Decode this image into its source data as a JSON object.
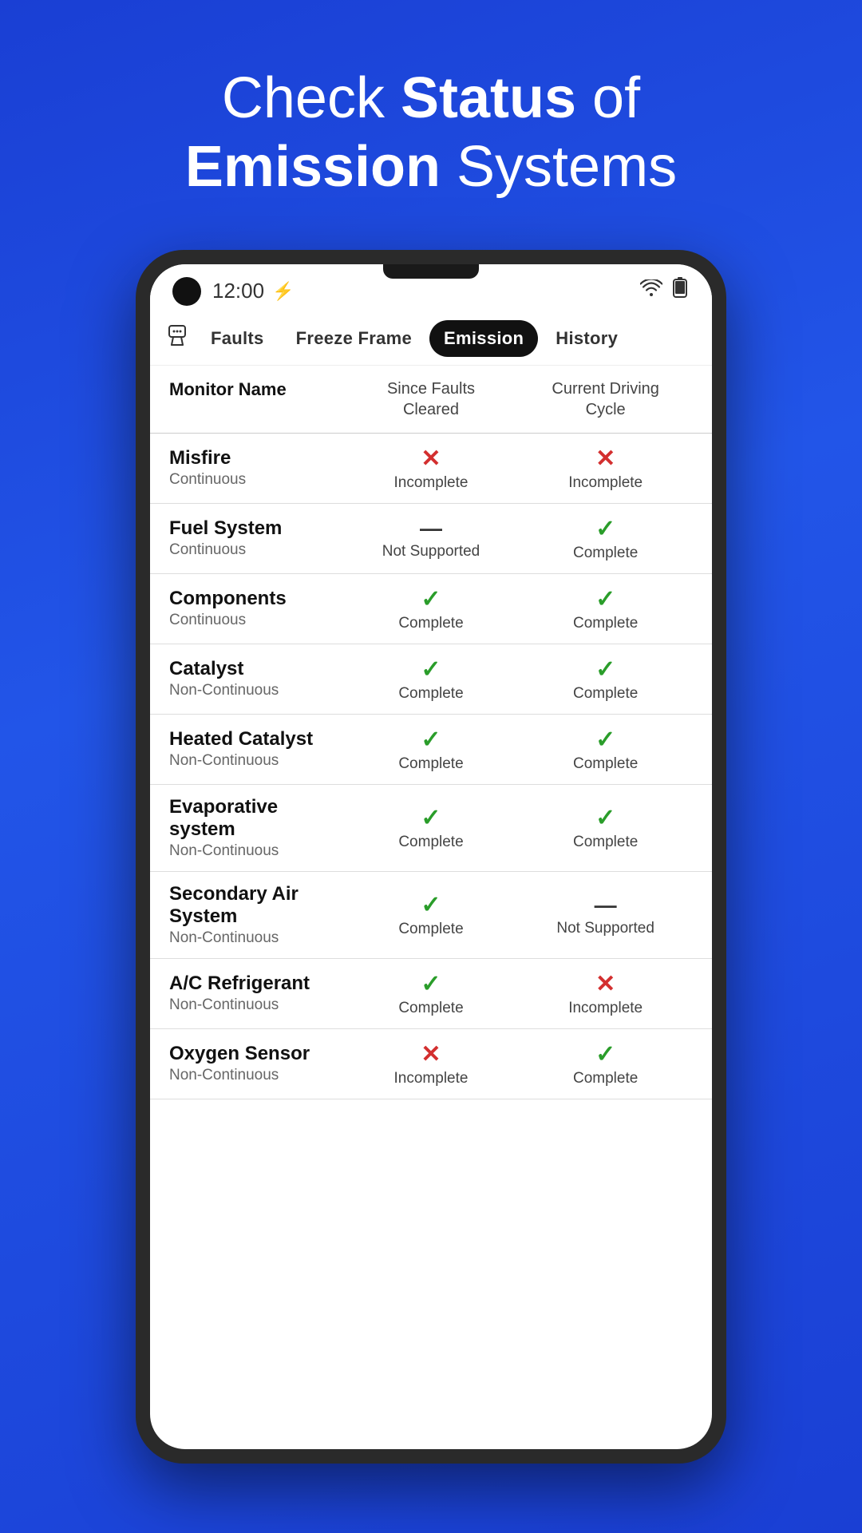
{
  "headline": {
    "line1_pre": "Check ",
    "line1_bold": "Status",
    "line1_post": " of",
    "line2_pre": "",
    "line2_bold": "Emission",
    "line2_post": " Systems"
  },
  "statusBar": {
    "time": "12:00",
    "flashlight_icon": "⚡",
    "wifi_icon": "▼",
    "battery_icon": "▮"
  },
  "navTabs": [
    {
      "id": "faults",
      "label": "Faults",
      "active": false
    },
    {
      "id": "freeze-frame",
      "label": "Freeze Frame",
      "active": false
    },
    {
      "id": "emission",
      "label": "Emission",
      "active": true
    },
    {
      "id": "history",
      "label": "History",
      "active": false
    }
  ],
  "tableHeaders": {
    "col1": "Monitor Name",
    "col2_line1": "Since Faults",
    "col2_line2": "Cleared",
    "col3_line1": "Current Driving",
    "col3_line2": "Cycle"
  },
  "tableRows": [
    {
      "name": "Misfire",
      "type": "Continuous",
      "col2_status": "incomplete",
      "col2_label": "Incomplete",
      "col3_status": "incomplete",
      "col3_label": "Incomplete"
    },
    {
      "name": "Fuel System",
      "type": "Continuous",
      "col2_status": "not-supported",
      "col2_label": "Not Supported",
      "col3_status": "complete",
      "col3_label": "Complete"
    },
    {
      "name": "Components",
      "type": "Continuous",
      "col2_status": "complete",
      "col2_label": "Complete",
      "col3_status": "complete",
      "col3_label": "Complete"
    },
    {
      "name": "Catalyst",
      "type": "Non-Continuous",
      "col2_status": "complete",
      "col2_label": "Complete",
      "col3_status": "complete",
      "col3_label": "Complete"
    },
    {
      "name": "Heated Catalyst",
      "type": "Non-Continuous",
      "col2_status": "complete",
      "col2_label": "Complete",
      "col3_status": "complete",
      "col3_label": "Complete"
    },
    {
      "name": "Evaporative system",
      "type": "Non-Continuous",
      "col2_status": "complete",
      "col2_label": "Complete",
      "col3_status": "complete",
      "col3_label": "Complete"
    },
    {
      "name": "Secondary Air System",
      "type": "Non-Continuous",
      "col2_status": "complete",
      "col2_label": "Complete",
      "col3_status": "not-supported",
      "col3_label": "Not Supported"
    },
    {
      "name": "A/C Refrigerant",
      "type": "Non-Continuous",
      "col2_status": "complete",
      "col2_label": "Complete",
      "col3_status": "incomplete",
      "col3_label": "Incomplete"
    },
    {
      "name": "Oxygen Sensor",
      "type": "Non-Continuous",
      "col2_status": "incomplete",
      "col2_label": "Incomplete",
      "col3_status": "complete",
      "col3_label": "Complete"
    }
  ]
}
